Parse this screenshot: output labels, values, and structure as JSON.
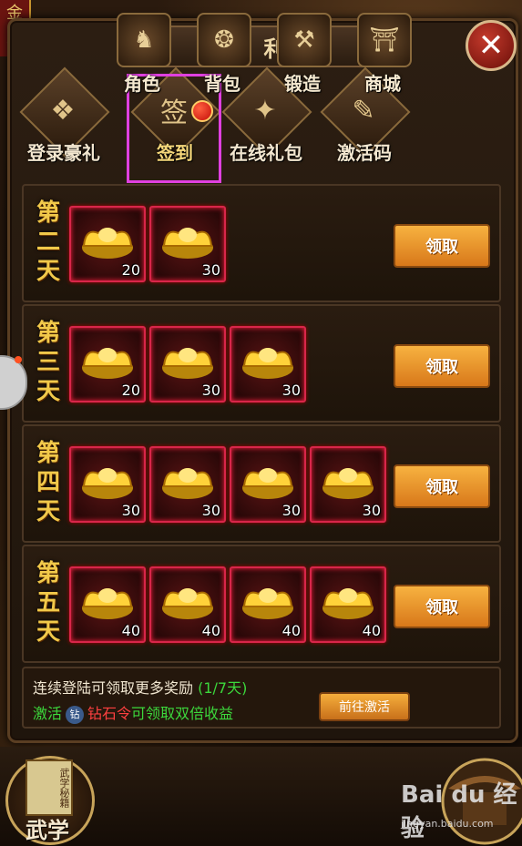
{
  "window": {
    "title": "福利",
    "close_label": "✕",
    "banner": "金盾"
  },
  "tabs": [
    {
      "label": "登录豪礼",
      "icon": "gift-chest-icon",
      "glyph": "❖"
    },
    {
      "label": "签到",
      "icon": "sign-in-scroll-icon",
      "glyph": "签",
      "active": true,
      "badge": true
    },
    {
      "label": "在线礼包",
      "icon": "gift-box-icon",
      "glyph": "✦"
    },
    {
      "label": "激活码",
      "icon": "activation-scroll-icon",
      "glyph": "✎"
    }
  ],
  "rows": [
    {
      "day": [
        "第",
        "二",
        "天"
      ],
      "items": [
        {
          "count": "20"
        },
        {
          "count": "30"
        }
      ],
      "claim_label": "领取"
    },
    {
      "day": [
        "第",
        "三",
        "天"
      ],
      "items": [
        {
          "count": "20"
        },
        {
          "count": "30"
        },
        {
          "count": "30"
        }
      ],
      "claim_label": "领取"
    },
    {
      "day": [
        "第",
        "四",
        "天"
      ],
      "items": [
        {
          "count": "30"
        },
        {
          "count": "30"
        },
        {
          "count": "30"
        },
        {
          "count": "30"
        }
      ],
      "claim_label": "领取"
    },
    {
      "day": [
        "第",
        "五",
        "天"
      ],
      "items": [
        {
          "count": "40"
        },
        {
          "count": "40"
        },
        {
          "count": "40"
        },
        {
          "count": "40"
        }
      ],
      "claim_label": "领取"
    }
  ],
  "info": {
    "line1_text": "连续登陆可领取更多奖励",
    "progress": "(1/7天)",
    "activate_word": "激活",
    "diamond_badge": "钻",
    "token_name": "钻石令",
    "benefit_text": "可领取双倍收益",
    "goto_label": "前往激活"
  },
  "bottom_nav": {
    "wuxue": {
      "label": "武学",
      "book_text": "武学秘籍"
    },
    "items": [
      {
        "label": "角色",
        "glyph": "♞"
      },
      {
        "label": "背包",
        "glyph": "❂"
      },
      {
        "label": "锻造",
        "glyph": "⚒"
      },
      {
        "label": "商城",
        "glyph": "⛩"
      }
    ]
  },
  "watermark": {
    "brand": "Bai du 经验",
    "url": "jingyan.baidu.com"
  },
  "colors": {
    "accent_gold": "#f1c94a",
    "claim_orange": "#f0a030",
    "highlight_magenta": "#e040e0",
    "slot_red": "#d8264a",
    "progress_green": "#3cd83c"
  }
}
